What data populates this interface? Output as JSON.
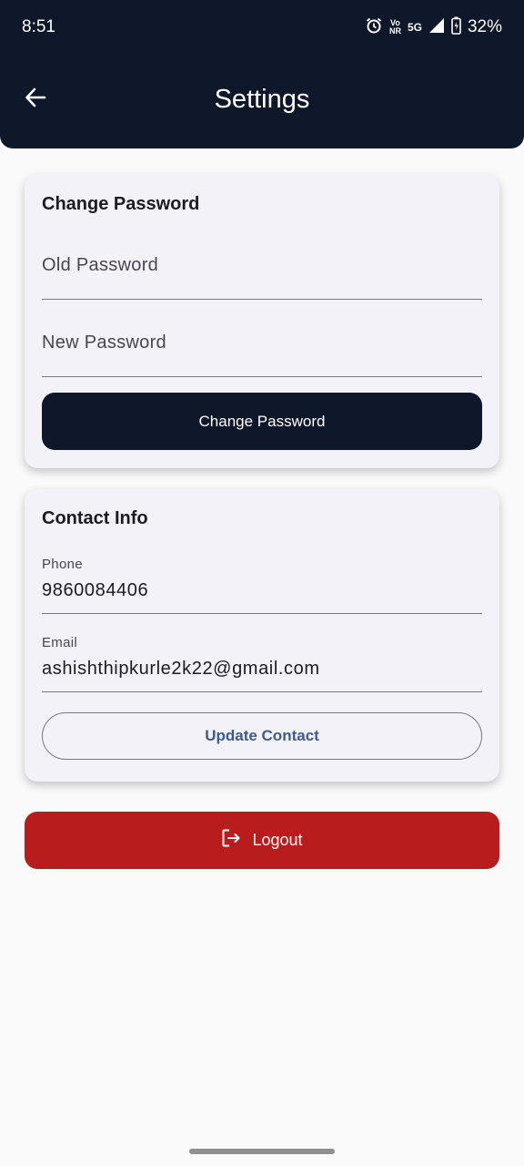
{
  "status_bar": {
    "time": "8:51",
    "volte_top": "Vo",
    "volte_bottom": "NR",
    "network": "5G",
    "battery": "32%"
  },
  "header": {
    "title": "Settings",
    "back_icon": "arrow-left-icon"
  },
  "password_card": {
    "title": "Change Password",
    "old_password_placeholder": "Old Password",
    "new_password_placeholder": "New Password",
    "button_label": "Change Password"
  },
  "contact_card": {
    "title": "Contact Info",
    "phone_label": "Phone",
    "phone_value": "9860084406",
    "email_label": "Email",
    "email_value": "ashishthipkurle2k22@gmail.com",
    "button_label": "Update Contact"
  },
  "logout": {
    "label": "Logout",
    "icon": "logout-icon"
  },
  "colors": {
    "header_bg": "#0f172a",
    "card_bg": "#f3f2f8",
    "primary_button": "#0f172a",
    "logout_button": "#b91c1c",
    "outline_text": "#3e5a8f"
  }
}
